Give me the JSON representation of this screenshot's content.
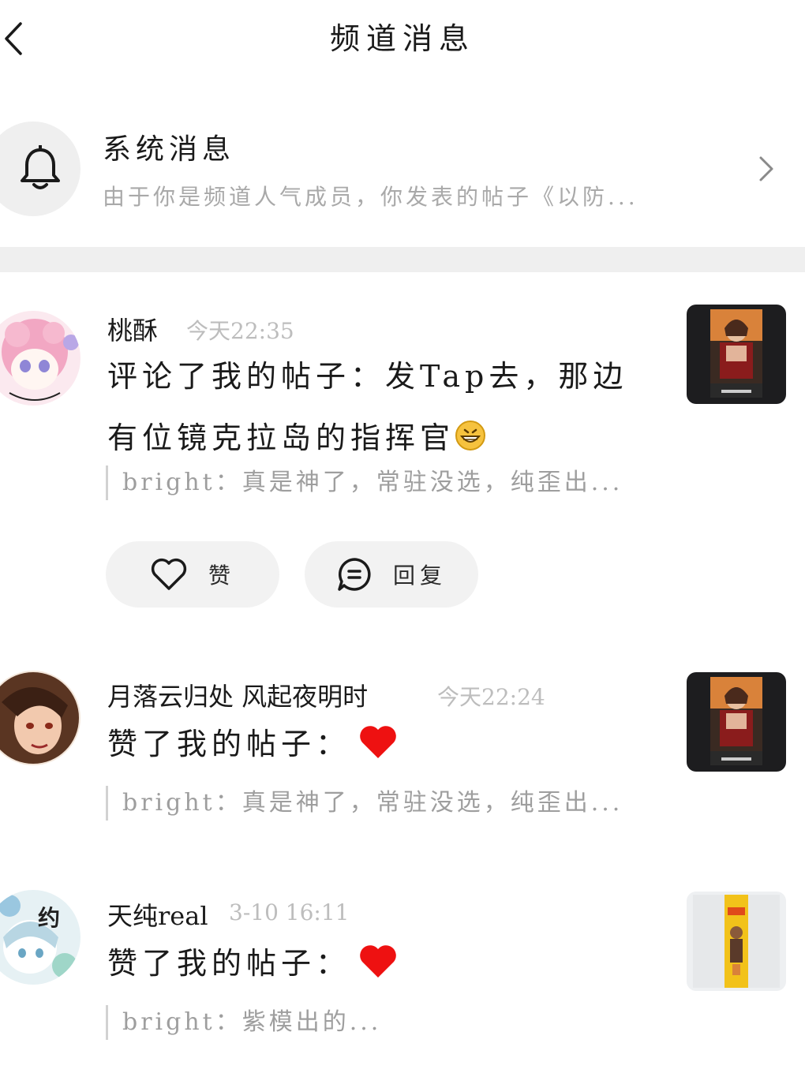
{
  "header": {
    "title": "频道消息"
  },
  "system": {
    "title": "系统消息",
    "preview": "由于你是频道人气成员，你发表的帖子《以防..."
  },
  "messages": [
    {
      "name": "桃酥",
      "time": "今天22:35",
      "action": "评论了我的帖子：发Tap去，那边有位镜克拉岛的指挥官",
      "quote": "bright：真是神了，常驻没选，纯歪出..."
    },
    {
      "name": "月落云归处 风起夜明时",
      "time": "今天22:24",
      "action": "赞了我的帖子：",
      "quote": "bright：真是神了，常驻没选，纯歪出..."
    },
    {
      "name": "天纯real",
      "time": "3-10 16:11",
      "action": "赞了我的帖子：",
      "quote": "bright：紫模出的..."
    }
  ],
  "buttons": {
    "like": "赞",
    "reply": "回复"
  },
  "avatar_badge": "约",
  "colors": {
    "heart": "#ee1111",
    "time": "#bdbdbd",
    "quote": "#9e9e9e",
    "pill": "#f2f2f2",
    "divider": "#efefef"
  }
}
